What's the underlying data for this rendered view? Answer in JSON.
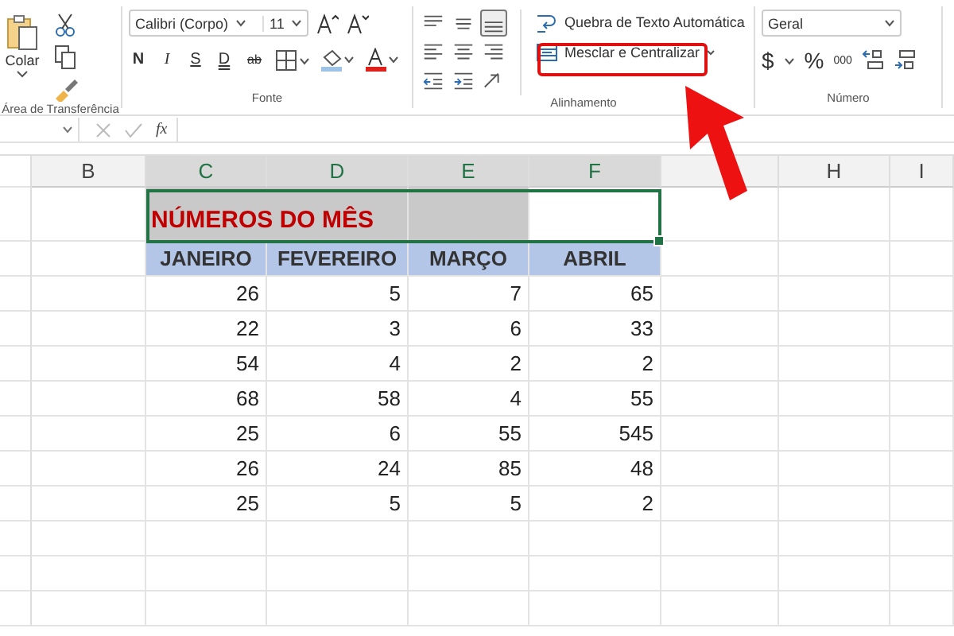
{
  "ribbon": {
    "clipboard": {
      "paste": "Colar",
      "label": "Área de Transferência"
    },
    "font": {
      "name": "Calibri (Corpo)",
      "size": "11",
      "styles": [
        "N",
        "I",
        "S",
        "D",
        "ab"
      ],
      "label": "Fonte"
    },
    "alignment": {
      "buttons": [
        {
          "kind": "top",
          "selected": false
        },
        {
          "kind": "middle",
          "selected": false
        },
        {
          "kind": "bottom",
          "selected": true
        },
        {
          "kind": "left",
          "selected": false
        },
        {
          "kind": "center",
          "selected": false
        },
        {
          "kind": "right",
          "selected": false
        },
        {
          "kind": "outdent",
          "selected": false
        },
        {
          "kind": "indent",
          "selected": false
        },
        {
          "kind": "orient",
          "selected": false
        }
      ],
      "wrap": "Quebra de Texto Automática",
      "merge": "Mesclar e Centralizar",
      "label": "Alinhamento"
    },
    "number": {
      "format": "Geral",
      "currency": "$",
      "percent": "%",
      "thousands": "000",
      "label": "Número"
    }
  },
  "formula_bar": {
    "fx": "fx"
  },
  "sheet": {
    "columns": [
      {
        "label": "B",
        "selected": false
      },
      {
        "label": "C",
        "selected": true
      },
      {
        "label": "D",
        "selected": true
      },
      {
        "label": "E",
        "selected": true
      },
      {
        "label": "F",
        "selected": true
      },
      {
        "selected": false
      },
      {
        "label": "H",
        "selected": false
      },
      {
        "label": "I",
        "selected": false
      }
    ],
    "title": "NÚMEROS DO MÊS",
    "headers": [
      "JANEIRO",
      "FEVEREIRO",
      "MARÇO",
      "ABRIL"
    ],
    "rows": [
      [
        "26",
        "5",
        "7",
        "65"
      ],
      [
        "22",
        "3",
        "6",
        "33"
      ],
      [
        "54",
        "4",
        "2",
        "2"
      ],
      [
        "68",
        "58",
        "4",
        "55"
      ],
      [
        "25",
        "6",
        "55",
        "545"
      ],
      [
        "26",
        "24",
        "85",
        "48"
      ],
      [
        "25",
        "5",
        "5",
        "2"
      ]
    ]
  }
}
